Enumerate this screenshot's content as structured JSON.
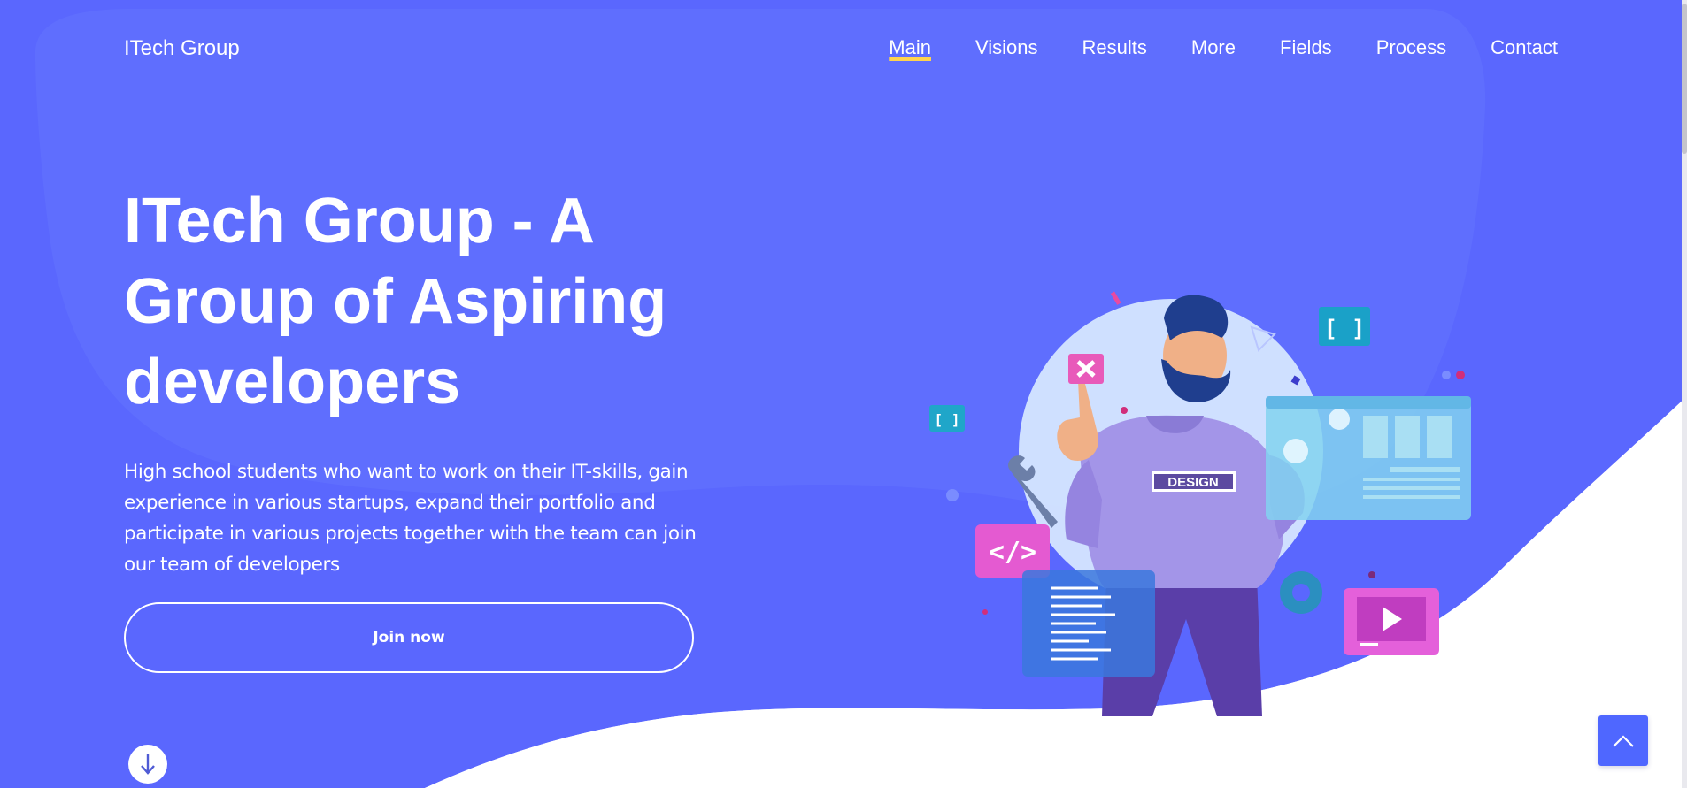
{
  "colors": {
    "hero_background": "#5a67fe",
    "hero_highlight": "#6776fe",
    "accent_underline": "#ffd34e",
    "back_to_top": "#4f67ff"
  },
  "header": {
    "brand": "ITech Group",
    "nav": [
      {
        "label": "Main",
        "active": true
      },
      {
        "label": "Visions"
      },
      {
        "label": "Results"
      },
      {
        "label": "More"
      },
      {
        "label": "Fields"
      },
      {
        "label": "Process"
      },
      {
        "label": "Contact"
      }
    ]
  },
  "hero": {
    "title_lines": [
      "ITech Group - A",
      "Group of Aspiring",
      "developers"
    ],
    "description": "High school students who want to work on their IT-skills, gain experience in various startups, expand their portfolio and participate in various projects together with the team can join our team of developers",
    "cta_label": "Join now"
  },
  "illustration": {
    "shirt_text": "DESIGN",
    "icons": [
      "code-brackets-icon",
      "close-icon",
      "gear-icon",
      "wrench-icon",
      "code-tag-icon",
      "play-icon",
      "document-icon",
      "browser-window-icon"
    ]
  },
  "controls": {
    "scroll_down_icon": "arrow-down-icon",
    "back_to_top_icon": "chevron-up-icon"
  }
}
